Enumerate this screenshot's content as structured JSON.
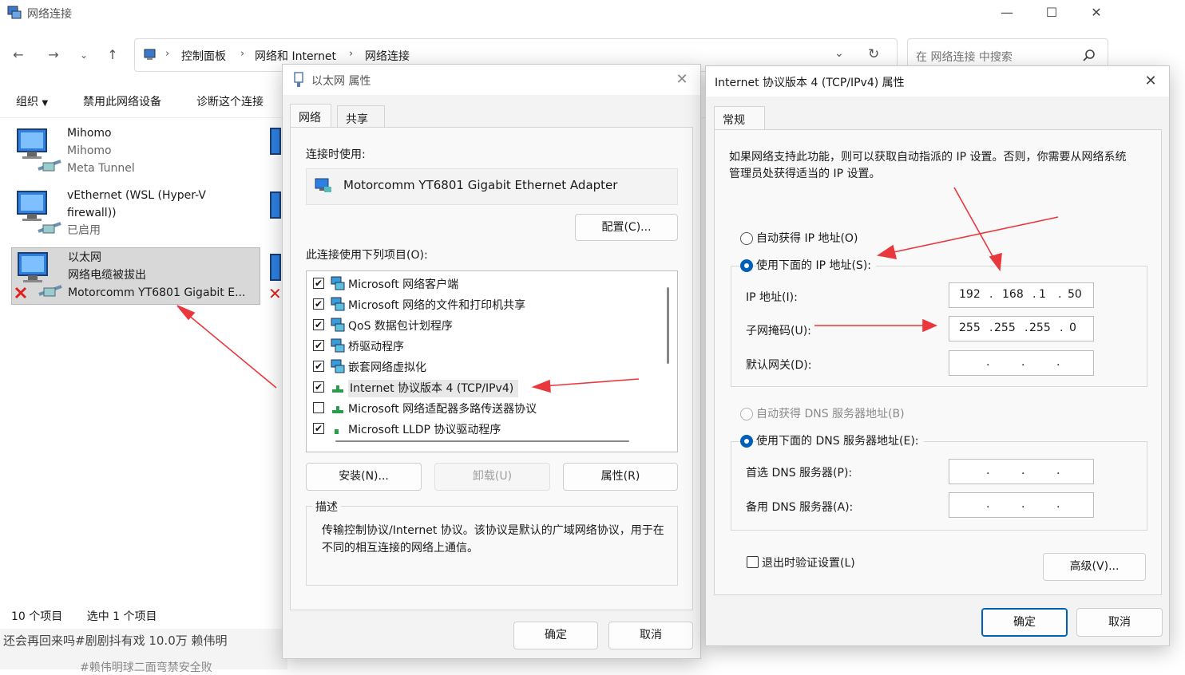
{
  "explorer": {
    "title": "网络连接",
    "breadcrumb": [
      "控制面板",
      "网络和 Internet",
      "网络连接"
    ],
    "search_placeholder": "在 网络连接 中搜索",
    "commands": [
      "组织",
      "禁用此网络设备",
      "诊断这个连接"
    ],
    "items": [
      {
        "name": "Mihomo",
        "line2": "Mihomo",
        "line3": "Meta Tunnel"
      },
      {
        "name": "vEthernet (WSL (Hyper-V",
        "line2": "firewall))",
        "line3": "已启用"
      },
      {
        "name": "以太网",
        "line2": "网络电缆被拔出",
        "line3": "Motorcomm YT6801 Gigabit E..."
      }
    ],
    "status": {
      "count": "10 个项目",
      "selected": "选中 1 个项目"
    },
    "bg_text": "还会再回来吗#剧剧抖有戏 10.0万 赖伟明",
    "bg_text2": "#赖伟明球二面弯禁安全败"
  },
  "eth_props": {
    "title": "以太网 属性",
    "tabs": [
      "网络",
      "共享"
    ],
    "connect_using_label": "连接时使用:",
    "adapter": "Motorcomm YT6801 Gigabit Ethernet Adapter",
    "configure_button": "配置(C)...",
    "items_label": "此连接使用下列项目(O):",
    "items": [
      {
        "label": "Microsoft 网络客户端",
        "checked": true
      },
      {
        "label": "Microsoft 网络的文件和打印机共享",
        "checked": true
      },
      {
        "label": "QoS 数据包计划程序",
        "checked": true
      },
      {
        "label": "桥驱动程序",
        "checked": true
      },
      {
        "label": "嵌套网络虚拟化",
        "checked": true
      },
      {
        "label": "Internet 协议版本 4 (TCP/IPv4)",
        "checked": true
      },
      {
        "label": "Microsoft 网络适配器多路传送器协议",
        "checked": false
      },
      {
        "label": "Microsoft LLDP 协议驱动程序",
        "checked": true
      }
    ],
    "check_mark": "✔",
    "install_button": "安装(N)...",
    "uninstall_button": "卸载(U)",
    "properties_button": "属性(R)",
    "description_label": "描述",
    "description": "传输控制协议/Internet 协议。该协议是默认的广域网络协议，用于在不同的相互连接的网络上通信。",
    "ok_button": "确定",
    "cancel_button": "取消"
  },
  "ipv4_props": {
    "title": "Internet 协议版本 4 (TCP/IPv4) 属性",
    "tab": "常规",
    "intro": "如果网络支持此功能，则可以获取自动指派的 IP 设置。否则，你需要从网络系统管理员处获得适当的 IP 设置。",
    "auto_ip_label": "自动获得 IP 地址(O)",
    "manual_ip_label": "使用下面的 IP 地址(S):",
    "ip_label": "IP 地址(I):",
    "ip": [
      "192",
      "168",
      "1",
      "50"
    ],
    "mask_label": "子网掩码(U):",
    "mask": [
      "255",
      "255",
      "255",
      "0"
    ],
    "gateway_label": "默认网关(D):",
    "auto_dns_label": "自动获得 DNS 服务器地址(B)",
    "manual_dns_label": "使用下面的 DNS 服务器地址(E):",
    "pref_dns_label": "首选 DNS 服务器(P):",
    "alt_dns_label": "备用 DNS 服务器(A):",
    "validate_label": "退出时验证设置(L)",
    "advanced_button": "高级(V)...",
    "ok_button": "确定",
    "cancel_button": "取消",
    "dot": "."
  },
  "colors": {
    "accent": "#005fb8",
    "arrow": "#e8383d",
    "selected_bg": "#d8d8d8"
  }
}
